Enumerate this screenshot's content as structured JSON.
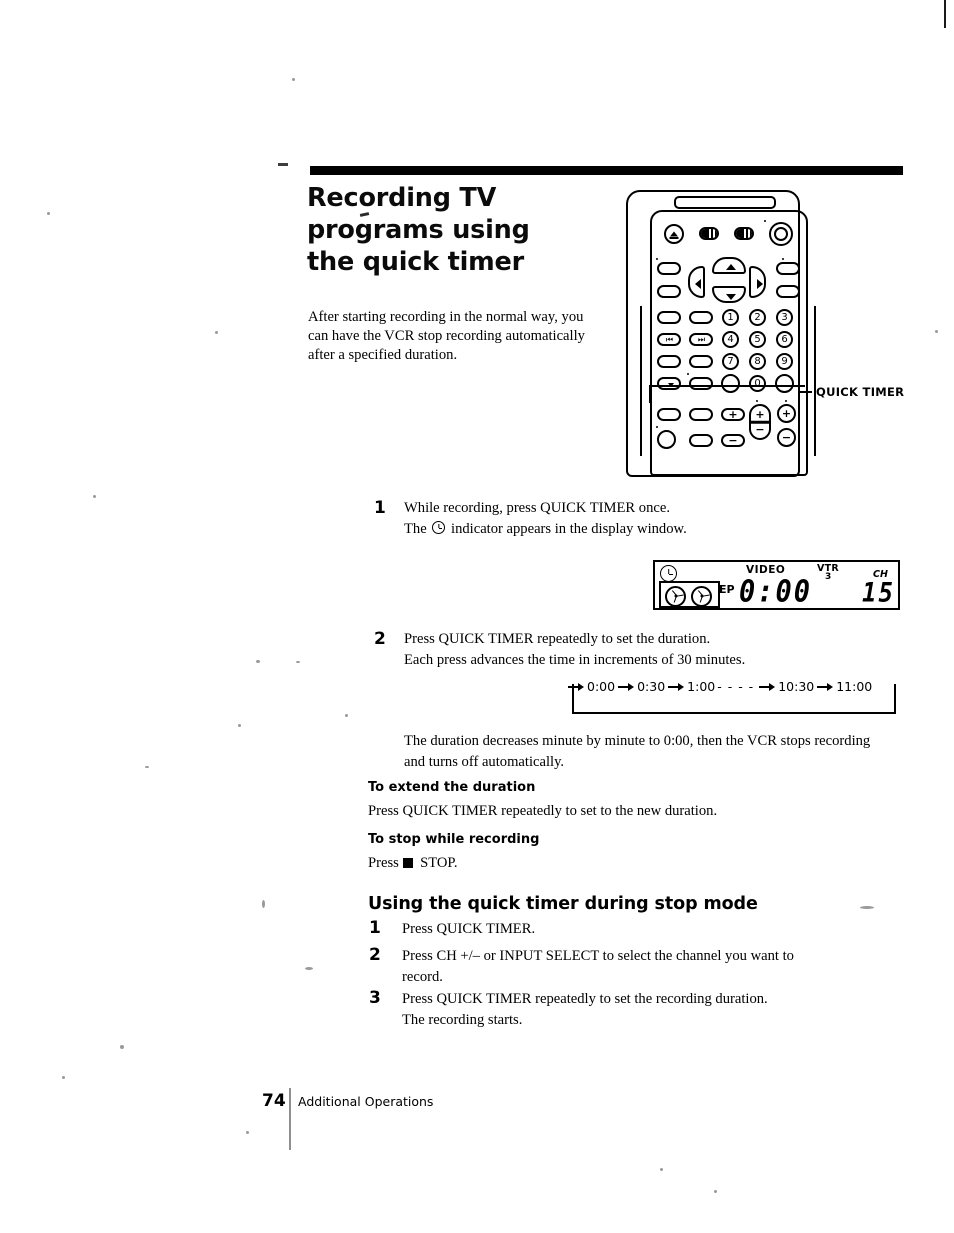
{
  "page": {
    "number": "74",
    "section": "Additional Operations"
  },
  "header": {
    "title_line1": "Recording TV",
    "title_line2": "programs using",
    "title_line3": "the quick timer",
    "intro": "After starting recording in the normal way, you can have the VCR stop recording automatically after a specified duration."
  },
  "remote": {
    "callout_label": "QUICK TIMER",
    "numbers": [
      "1",
      "2",
      "3",
      "4",
      "5",
      "6",
      "7",
      "8",
      "9",
      "0"
    ],
    "skip_back_icon": "skip-back-icon",
    "skip_forward_icon": "skip-forward-icon",
    "eject_icon": "eject-icon",
    "power_icon": "power-icon",
    "plus_symbol": "+",
    "minus_symbol": "−"
  },
  "steps": [
    {
      "number": "1",
      "line1": "While recording, press QUICK TIMER once.",
      "line2_before": "The",
      "line2_after": "indicator appears in the display window."
    },
    {
      "number": "2",
      "line1": "Press QUICK TIMER repeatedly to set the duration.",
      "line2": "Each press advances the time in increments of 30 minutes."
    }
  ],
  "display_window": {
    "clock_icon": "clock-icon",
    "tape_icon": "tape-reels-icon",
    "speed_mode": "EP",
    "video_label": "VIDEO",
    "vtr_label": "VTR",
    "vtr_number": "3",
    "time": "0:00",
    "ch_label": "CH",
    "channel": "15"
  },
  "sequence": {
    "items": [
      "0:00",
      "0:30",
      "1:00",
      "10:30",
      "11:00"
    ],
    "dashes": "- - - -"
  },
  "notes": {
    "after_sequence": "The duration decreases minute by minute to 0:00, then the VCR stops recording and turns off automatically."
  },
  "subsections": [
    {
      "heading": "To extend the duration",
      "body": "Press QUICK TIMER repeatedly to set to the new duration."
    },
    {
      "heading": "To stop while recording",
      "body_before": "Press",
      "body_after": "STOP."
    }
  ],
  "stop_mode": {
    "heading": "Using the quick timer during stop mode",
    "steps": [
      {
        "number": "1",
        "line1": "Press QUICK TIMER.",
        "line2": ""
      },
      {
        "number": "2",
        "line1": "Press CH +/– or INPUT SELECT to select the channel you want to",
        "line2": "record."
      },
      {
        "number": "3",
        "line1": "Press QUICK TIMER repeatedly to set the recording duration.",
        "line2": "The recording starts."
      }
    ]
  }
}
